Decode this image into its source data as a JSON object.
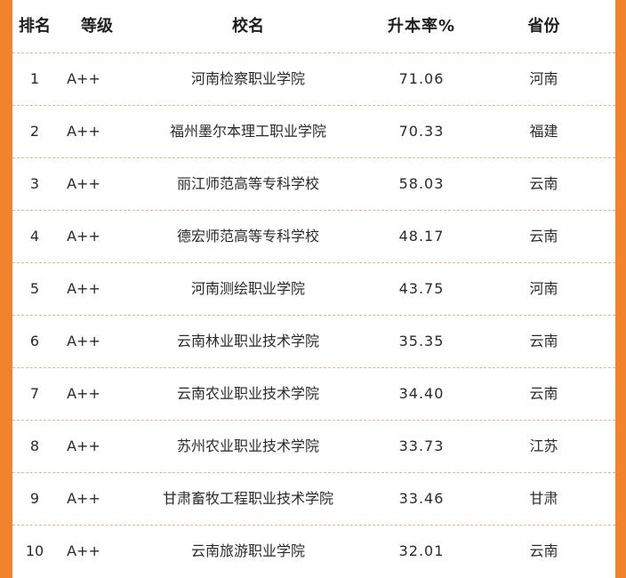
{
  "table": {
    "headers": {
      "rank": "排名",
      "grade": "等级",
      "name": "校名",
      "rate": "升本率%",
      "province": "省份"
    },
    "rows": [
      {
        "rank": "1",
        "grade": "A++",
        "name": "河南检察职业学院",
        "rate": "71.06",
        "province": "河南"
      },
      {
        "rank": "2",
        "grade": "A++",
        "name": "福州墨尔本理工职业学院",
        "rate": "70.33",
        "province": "福建"
      },
      {
        "rank": "3",
        "grade": "A++",
        "name": "丽江师范高等专科学校",
        "rate": "58.03",
        "province": "云南"
      },
      {
        "rank": "4",
        "grade": "A++",
        "name": "德宏师范高等专科学校",
        "rate": "48.17",
        "province": "云南"
      },
      {
        "rank": "5",
        "grade": "A++",
        "name": "河南测绘职业学院",
        "rate": "43.75",
        "province": "河南"
      },
      {
        "rank": "6",
        "grade": "A++",
        "name": "云南林业职业技术学院",
        "rate": "35.35",
        "province": "云南"
      },
      {
        "rank": "7",
        "grade": "A++",
        "name": "云南农业职业技术学院",
        "rate": "34.40",
        "province": "云南"
      },
      {
        "rank": "8",
        "grade": "A++",
        "name": "苏州农业职业技术学院",
        "rate": "33.73",
        "province": "江苏"
      },
      {
        "rank": "9",
        "grade": "A++",
        "name": "甘肃畜牧工程职业技术学院",
        "rate": "33.46",
        "province": "甘肃"
      },
      {
        "rank": "10",
        "grade": "A++",
        "name": "云南旅游职业学院",
        "rate": "32.01",
        "province": "云南"
      }
    ]
  }
}
